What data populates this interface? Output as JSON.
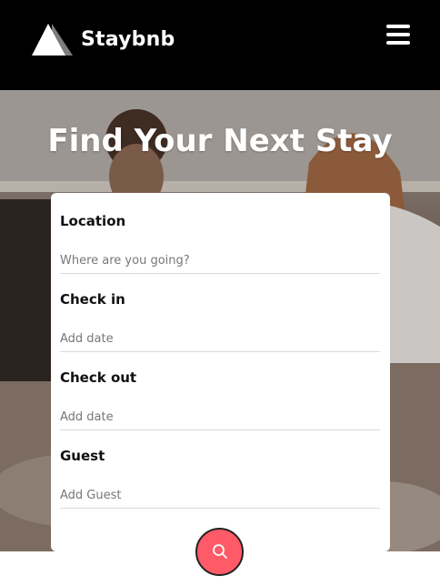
{
  "header": {
    "brand": "Staybnb",
    "logo_icon": "triangle-logo-icon",
    "menu_icon": "hamburger-menu-icon"
  },
  "hero": {
    "title": "Find Your Next Stay"
  },
  "form": {
    "location": {
      "label": "Location",
      "placeholder": "Where are you going?"
    },
    "check_in": {
      "label": "Check in",
      "placeholder": "Add date"
    },
    "check_out": {
      "label": "Check out",
      "placeholder": "Add date"
    },
    "guest": {
      "label": "Guest",
      "placeholder": "Add Guest"
    },
    "search_icon": "search-icon"
  },
  "colors": {
    "header_bg": "#000000",
    "accent": "#ff5a67"
  }
}
